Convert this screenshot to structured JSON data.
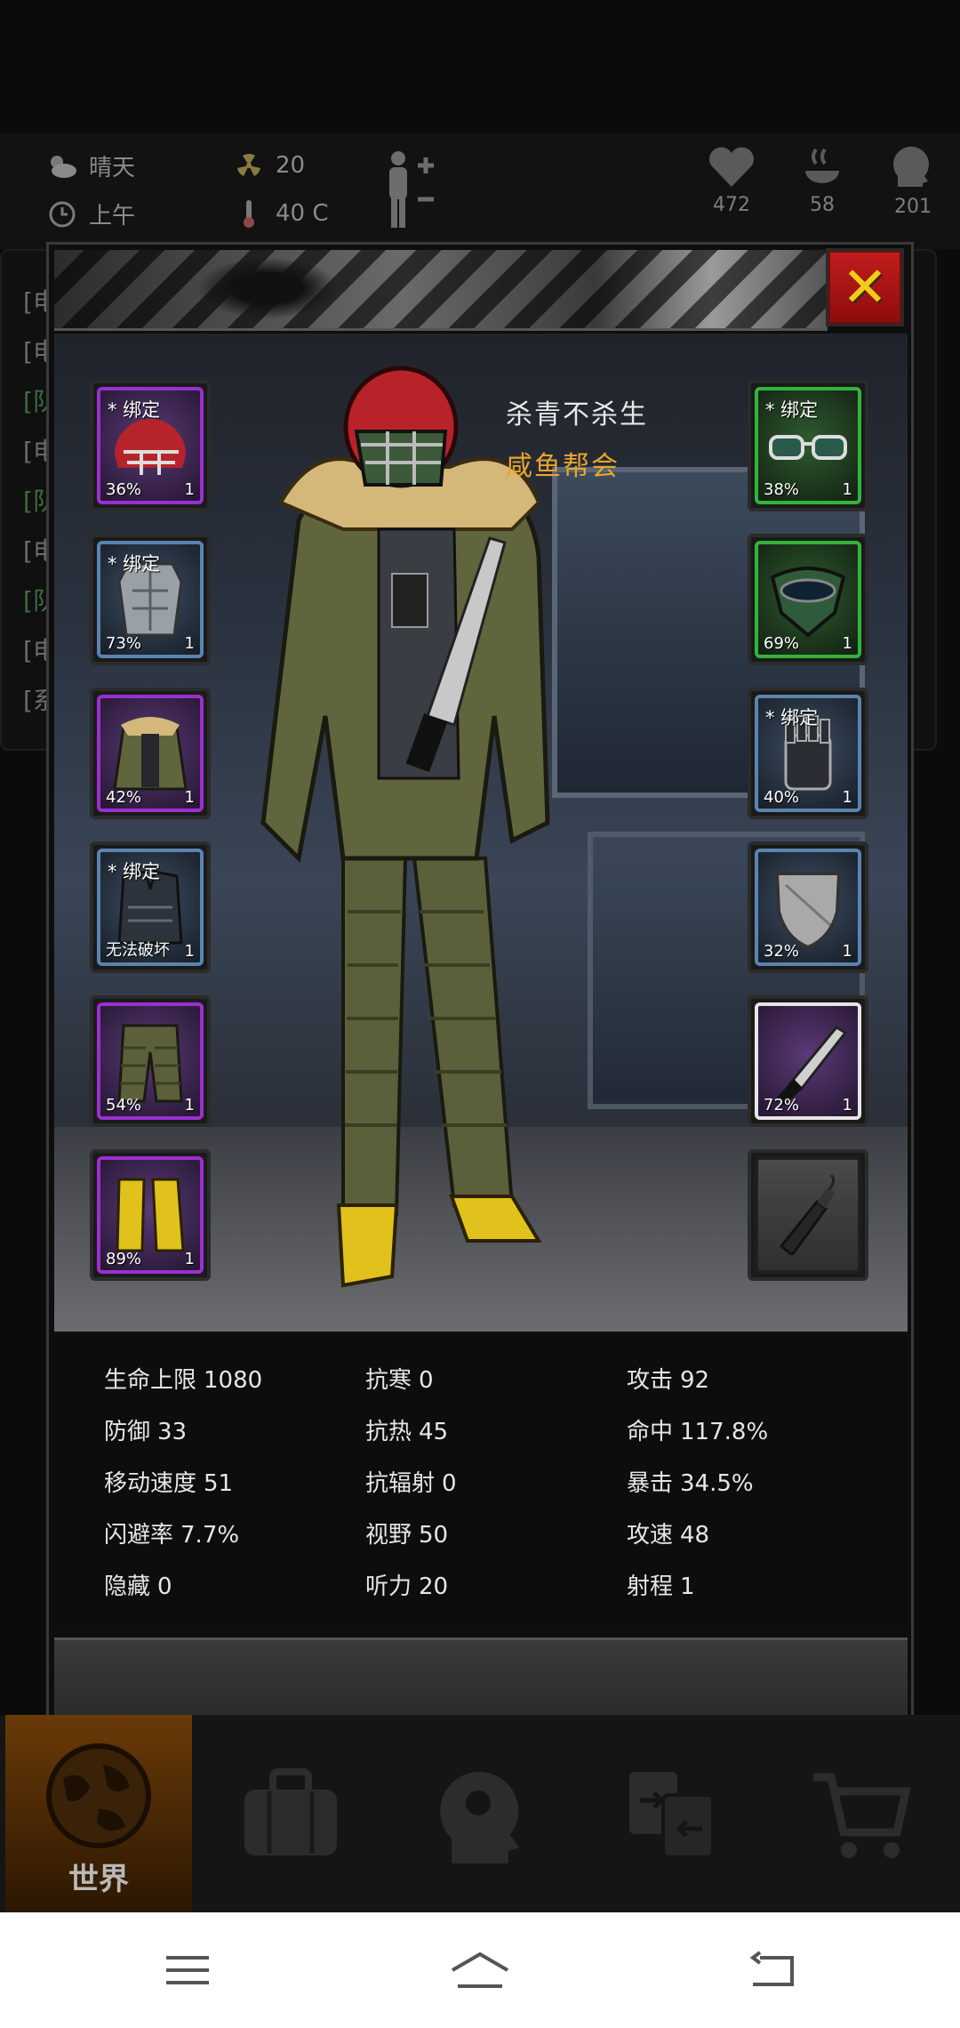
{
  "hud": {
    "weather": "晴天",
    "time_of_day": "上午",
    "radiation": "20",
    "temperature": "40 C",
    "health": "472",
    "food": "58",
    "mind": "201"
  },
  "background_log": {
    "lines": [
      "[电",
      "[电",
      "[队",
      "[电",
      "[队",
      "[电",
      "[队",
      "[电",
      "[系"
    ]
  },
  "player": {
    "name": "杀青不杀生",
    "guild": "咸鱼帮会"
  },
  "left_slots": [
    {
      "icon": "helmet-icon",
      "bind": "* 绑定",
      "durability": "36%",
      "count": "1",
      "rarity": "purple"
    },
    {
      "icon": "body-armor-icon",
      "bind": "* 绑定",
      "durability": "73%",
      "count": "1",
      "rarity": "blue"
    },
    {
      "icon": "jacket-icon",
      "bind": "",
      "durability": "42%",
      "count": "1",
      "rarity": "purple"
    },
    {
      "icon": "vest-icon",
      "bind": "* 绑定",
      "durability": "无法破坏",
      "count": "1",
      "rarity": "blue"
    },
    {
      "icon": "pants-icon",
      "bind": "",
      "durability": "54%",
      "count": "1",
      "rarity": "purple"
    },
    {
      "icon": "boots-icon",
      "bind": "",
      "durability": "89%",
      "count": "1",
      "rarity": "purple"
    }
  ],
  "right_slots": [
    {
      "icon": "glasses-icon",
      "bind": "* 绑定",
      "durability": "38%",
      "count": "1",
      "rarity": "green"
    },
    {
      "icon": "mask-icon",
      "bind": "",
      "durability": "69%",
      "count": "1",
      "rarity": "green"
    },
    {
      "icon": "gloves-icon",
      "bind": "* 绑定",
      "durability": "40%",
      "count": "1",
      "rarity": "blue"
    },
    {
      "icon": "shield-icon",
      "bind": "",
      "durability": "32%",
      "count": "1",
      "rarity": "blue"
    },
    {
      "icon": "machete-icon",
      "bind": "",
      "durability": "72%",
      "count": "1",
      "rarity": "white"
    },
    {
      "icon": "molotov-icon",
      "bind": "",
      "durability": "",
      "count": "",
      "rarity": "empty"
    }
  ],
  "stats": [
    {
      "label": "生命上限",
      "value": "1080"
    },
    {
      "label": "抗寒",
      "value": "0"
    },
    {
      "label": "攻击",
      "value": "92"
    },
    {
      "label": "防御",
      "value": "33"
    },
    {
      "label": "抗热",
      "value": "45"
    },
    {
      "label": "命中",
      "value": "117.8%"
    },
    {
      "label": "移动速度",
      "value": "51"
    },
    {
      "label": "抗辐射",
      "value": "0"
    },
    {
      "label": "暴击",
      "value": "34.5%"
    },
    {
      "label": "闪避率",
      "value": "7.7%"
    },
    {
      "label": "视野",
      "value": "50"
    },
    {
      "label": "攻速",
      "value": "48"
    },
    {
      "label": "隐藏",
      "value": "0"
    },
    {
      "label": "听力",
      "value": "20"
    },
    {
      "label": "射程",
      "value": "1"
    }
  ],
  "game_nav": {
    "world_label": "世界"
  },
  "colors": {
    "close_red": "#c21d1d",
    "close_x": "#f2cc1a",
    "guild": "#e8a52c",
    "purple": "#9c2fd1",
    "blue": "#5b83b0",
    "green": "#32b33a"
  }
}
